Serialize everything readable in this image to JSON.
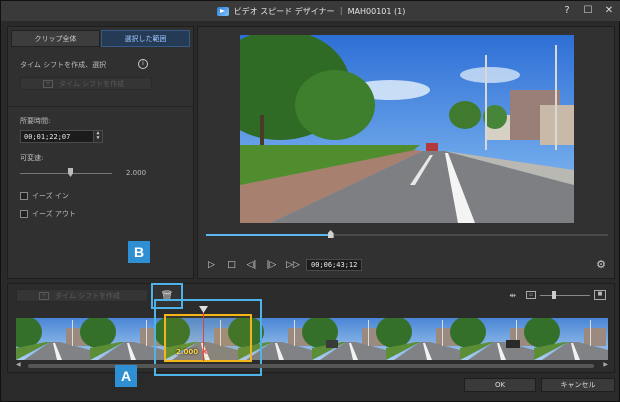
{
  "window": {
    "title": "ビデオ スピード デザイナー ｜ MAH00101 (1)",
    "help_label": "?",
    "maximize_label": "☐",
    "close_label": "✕"
  },
  "left_panel": {
    "tabs": [
      {
        "label": "クリップ全体",
        "active": false
      },
      {
        "label": "選択した範囲",
        "active": true
      }
    ],
    "time_shift_label": "タイム シフトを作成、選択",
    "info_icon_glyph": "i",
    "create_shift_label": "タイム シフトを作成",
    "duration_label": "所要時間:",
    "duration_value": "00;01;22;07",
    "variable_speed_label": "可変速:",
    "speed_value": "2.000",
    "ease_in_label": "イーズ イン",
    "ease_out_label": "イーズ アウト"
  },
  "preview": {
    "timecode": "00;06;43;12",
    "progress_fraction": 0.31
  },
  "timeline": {
    "create_shift_label": "タイム シフトを作成",
    "selection_speed_label": "2.000",
    "selection_x_label": "X"
  },
  "callouts": {
    "a": "A",
    "b": "B"
  },
  "buttons": {
    "ok": "OK",
    "cancel": "キャンセル"
  },
  "colors": {
    "accent": "#4fb3e8",
    "selection": "#f3b51a",
    "playhead": "#e24040"
  }
}
